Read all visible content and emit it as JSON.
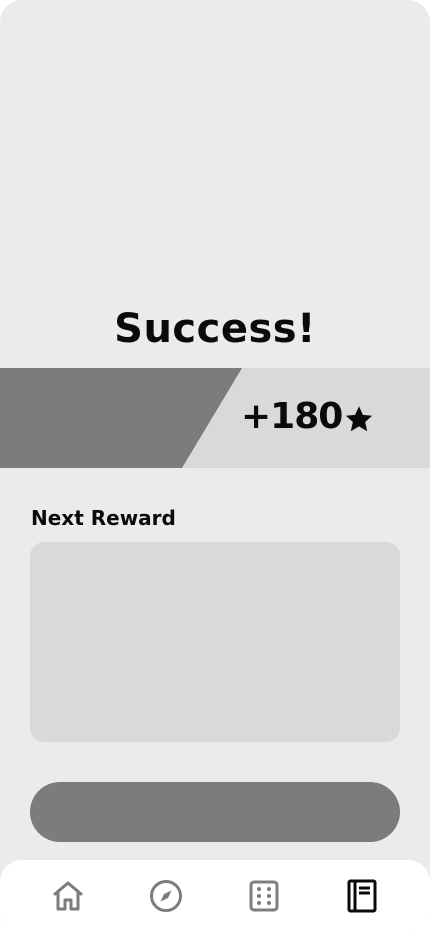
{
  "result": {
    "title": "Success!",
    "reward_amount": "+180",
    "reward_icon": "star-icon"
  },
  "next_reward": {
    "label": "Next Reward"
  },
  "bottom_nav": {
    "items": [
      {
        "icon": "home-icon",
        "active": false
      },
      {
        "icon": "compass-icon",
        "active": false
      },
      {
        "icon": "dice-icon",
        "active": false
      },
      {
        "icon": "notebook-icon",
        "active": true
      }
    ]
  },
  "colors": {
    "background": "#ebebeb",
    "placeholder": "#d9d9d9",
    "dark_gray": "#7c7c7c",
    "text": "#0a0a0a",
    "nav_inactive": "#7c7c7c",
    "nav_active": "#0a0a0a"
  }
}
